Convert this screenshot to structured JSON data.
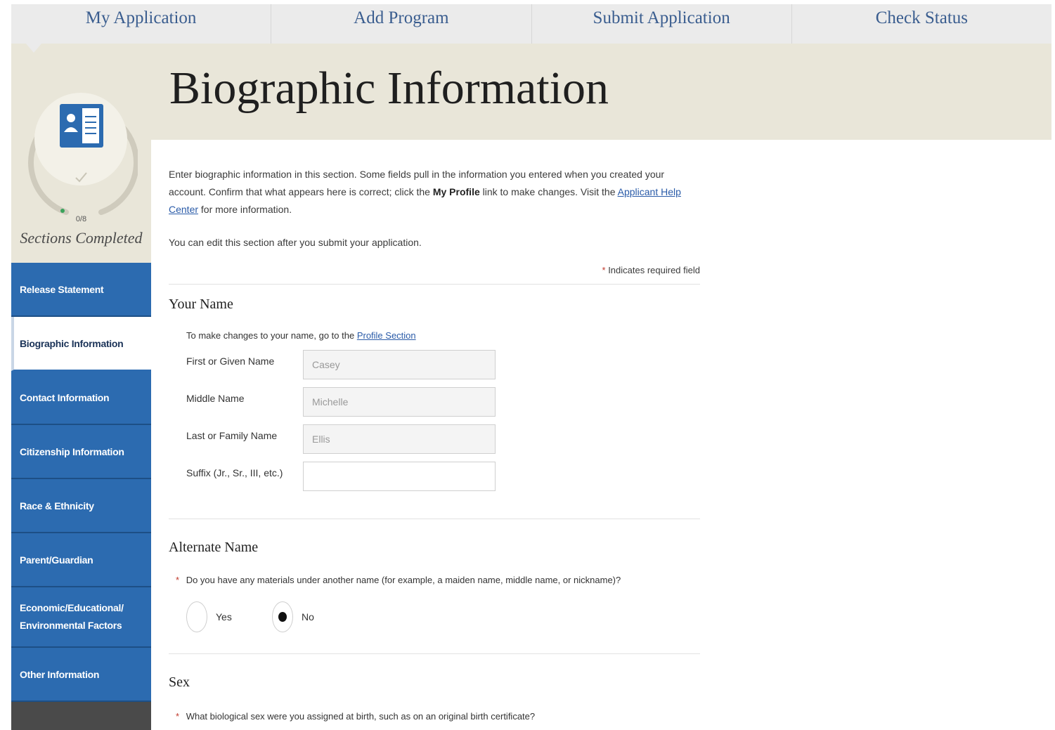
{
  "topnav": {
    "tabs": [
      {
        "label": "My Application"
      },
      {
        "label": "Add Program"
      },
      {
        "label": "Submit Application"
      },
      {
        "label": "Check Status"
      }
    ]
  },
  "progress": {
    "count": "0/8",
    "label": "Sections Completed",
    "completed_fraction": 0.0,
    "icon": "id-card-icon"
  },
  "sidebar": {
    "items": [
      {
        "label": "Release Statement"
      },
      {
        "label": "Biographic Information"
      },
      {
        "label": "Contact Information"
      },
      {
        "label": "Citizenship Information"
      },
      {
        "label": "Race & Ethnicity"
      },
      {
        "label": "Parent/Guardian"
      },
      {
        "label": "Economic/Educational/ Environmental Factors"
      },
      {
        "label": "Other Information"
      }
    ],
    "active_index": 1
  },
  "page": {
    "title": "Biographic Information",
    "intro_part1": "Enter biographic information in this section. Some fields pull in the information you entered when you created your account. Confirm that what appears here is correct; click the ",
    "intro_bold": "My Profile",
    "intro_part2": " link to make changes. Visit the ",
    "intro_link": "Applicant Help Center",
    "intro_part3": " for more information.",
    "edit_note": "You can edit this section after you submit your application.",
    "required_note": "Indicates required field",
    "required_star": "*"
  },
  "your_name": {
    "heading": "Your Name",
    "note_prefix": "To make changes to your name, go to the ",
    "note_link": "Profile Section",
    "fields": [
      {
        "label": "First or Given Name",
        "value": "Casey"
      },
      {
        "label": "Middle Name",
        "value": "Michelle"
      },
      {
        "label": "Last or Family Name",
        "value": "Ellis"
      },
      {
        "label": "Suffix (Jr., Sr., III, etc.)",
        "value": ""
      }
    ]
  },
  "alternate_name": {
    "heading": "Alternate Name",
    "question": "Do you have any materials under another name (for example, a maiden name, middle name, or nickname)?",
    "options": [
      {
        "label": "Yes",
        "selected": false
      },
      {
        "label": "No",
        "selected": true
      }
    ]
  },
  "sex": {
    "heading": "Sex",
    "question": "What biological sex were you assigned at birth, such as on an original birth certificate?"
  },
  "colors": {
    "nav_blue": "#2c6bb0",
    "band_beige": "#e9e6d9",
    "link_blue": "#2a5ba8",
    "required_red": "#c0392b"
  }
}
